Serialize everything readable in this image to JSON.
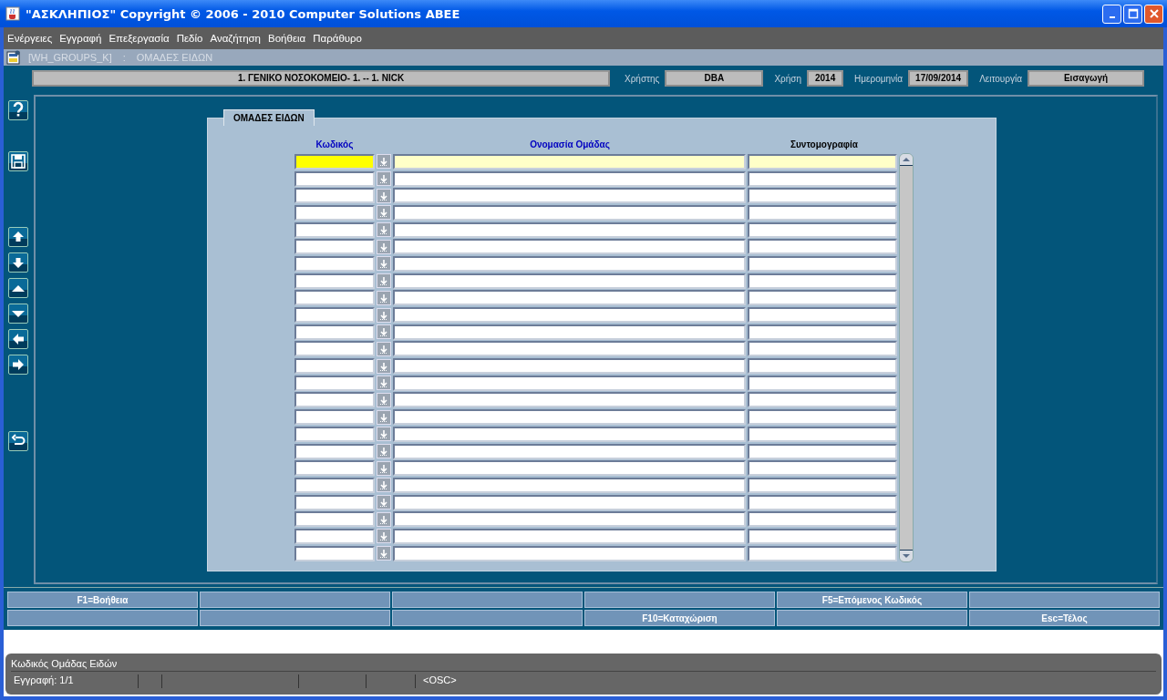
{
  "window": {
    "title": "\"ΑΣΚΛΗΠΙΟΣ\" Copyright © 2006 - 2010 Computer Solutions ABEE"
  },
  "menu": [
    "Ενέργειες",
    "Εγγραφή",
    "Επεξεργασία",
    "Πεδίο",
    "Αναζήτηση",
    "Βοήθεια",
    "Παράθυρο"
  ],
  "form_title": {
    "code": "[WH_GROUPS_K]",
    "separator": ":",
    "name": "ΟΜΑΔΕΣ ΕΙΔΩΝ"
  },
  "header": {
    "organization": "1. ΓΕΝΙΚΟ ΝΟΣΟΚΟΜΕΙΟ- 1. -- 1. NICK",
    "fields": [
      {
        "label": "Χρήστης",
        "value": "DBA"
      },
      {
        "label": "Χρήση",
        "value": "2014"
      },
      {
        "label": "Ημερομηνία",
        "value": "17/09/2014"
      },
      {
        "label": "Λειτουργία",
        "value": "Εισαγωγή"
      }
    ]
  },
  "tab": {
    "label": "ΟΜΑΔΕΣ ΕΙΔΩΝ"
  },
  "table": {
    "columns": [
      {
        "label": "Κωδικός",
        "color": "#0000c0"
      },
      {
        "label": "Ονομασία Ομάδας",
        "color": "#0000c0"
      },
      {
        "label": "Συντομογραφία",
        "color": "#000000"
      }
    ],
    "rows": [
      {
        "current": true
      },
      {
        "current": false
      },
      {
        "current": false
      },
      {
        "current": false
      },
      {
        "current": false
      },
      {
        "current": false
      },
      {
        "current": false
      },
      {
        "current": false
      },
      {
        "current": false
      },
      {
        "current": false
      },
      {
        "current": false
      },
      {
        "current": false
      },
      {
        "current": false
      },
      {
        "current": false
      },
      {
        "current": false
      },
      {
        "current": false
      },
      {
        "current": false
      },
      {
        "current": false
      },
      {
        "current": false
      },
      {
        "current": false
      },
      {
        "current": false
      },
      {
        "current": false
      },
      {
        "current": false
      },
      {
        "current": false
      }
    ]
  },
  "function_keys": [
    {
      "label": "F1=Βοήθεια"
    },
    {
      "label": "F5=Επόμενος Κωδικός"
    },
    {
      "label": "F10=Καταχώριση"
    },
    {
      "label": "Esc=Τέλος"
    }
  ],
  "status_bar": {
    "message": "Κωδικός Ομάδας Ειδών",
    "record": "Εγγραφή: 1/1",
    "mode": "<OSC>"
  }
}
